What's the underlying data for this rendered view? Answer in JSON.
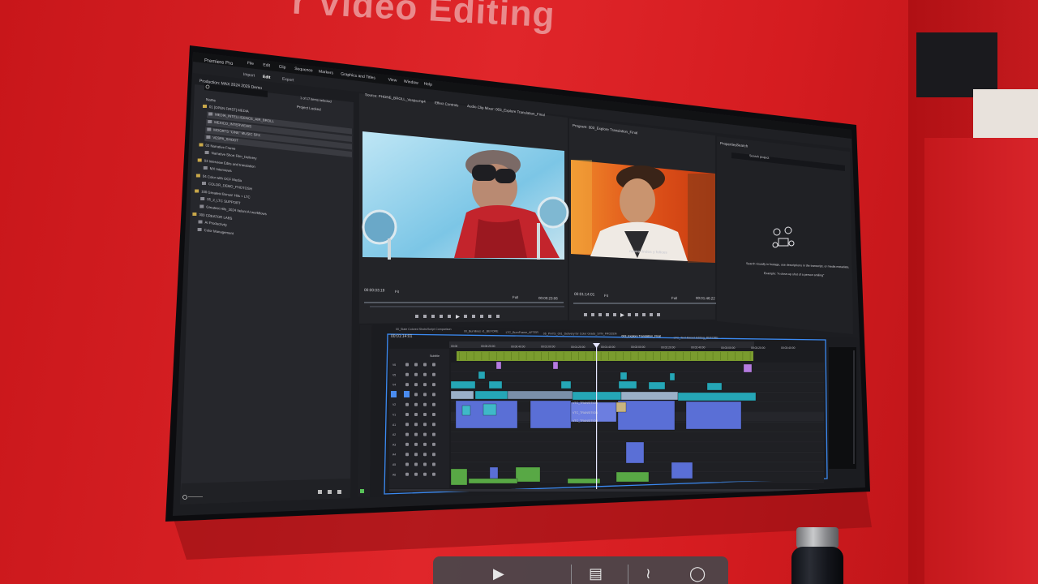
{
  "scene": {
    "wall_headline": "r Video Editing",
    "wall_color": "#d71e22"
  },
  "app": {
    "name": "Premiere Pro",
    "menus": [
      "File",
      "Edit",
      "Clip",
      "Sequence",
      "Markers",
      "Graphics and Titles",
      "View",
      "Window",
      "Help"
    ],
    "workspace_tabs": [
      "Import",
      "Edit",
      "Export"
    ],
    "production_title": "Production: MAX 2024 2025 Demo"
  },
  "project_panel": {
    "column_name": "Name",
    "column_status": "Project Locked",
    "items_selected": "1 of 17 items selected",
    "items": [
      {
        "label": "01 [OPEN FIRST] MEDIA",
        "level": 0
      },
      {
        "label": "MEDIA_INTELLIGENCE_AIR_BROLL",
        "level": 1
      },
      {
        "label": "MEXICO_INTERVIEWS",
        "level": 1
      },
      {
        "label": "MOGRTS \"CINE\" MUSIC SFX",
        "level": 1
      },
      {
        "label": "VESPA_SHOOT",
        "level": 1
      },
      {
        "label": "02 Narrative Frame",
        "level": 0
      },
      {
        "label": "Narrative Short Film_Delivery",
        "level": 1
      },
      {
        "label": "03 Interview Edits and translation",
        "level": 0
      },
      {
        "label": "MX Interviews",
        "level": 1
      },
      {
        "label": "04 Color with OCF Media",
        "level": 0
      },
      {
        "label": "COLOR_DEMO_PHOTOSH",
        "level": 1
      },
      {
        "label": "100 Greatest Bonus! Hits + LTC",
        "level": 0
      },
      {
        "label": "05_2_LTC SUPPORT",
        "level": 1
      },
      {
        "label": "Greatest Hits_2024 Itelani AI workflows",
        "level": 1
      },
      {
        "label": "300 CREATOR LABS",
        "level": 0
      },
      {
        "label": "AI Productivity",
        "level": 1
      },
      {
        "label": "Color Management",
        "level": 1
      }
    ]
  },
  "source_monitor": {
    "tab_label": "Source: PHONE_BROLL_Vespa.mp4",
    "tab_effect_controls": "Effect Controls",
    "tab_audio_mixer": "Audio Clip Mixer: 003_Explore Translation_Final",
    "timecode_in": "00:00:03:19",
    "fit": "Fit",
    "timecode_out": "00:00:23:06",
    "ratio": "Full"
  },
  "program_monitor": {
    "tab_label": "Program: 003_Explore Translation_Final",
    "caption_line": "nuevo lindos y felices",
    "timecode_in": "00:01:14:01",
    "fit": "Fit",
    "timecode_out": "00:01:46:22",
    "ratio": "Full"
  },
  "properties_panel": {
    "tab_properties": "Properties",
    "tab_search": "Search",
    "search_placeholder": "Search project",
    "hint_line_1": "Search visually in footage, use descriptions in the transcript, or media metadata.",
    "hint_line_2": "Example: \"A close-up shot of a person smiling\""
  },
  "timeline": {
    "tabs": [
      "00_Slate Colored Shots/Script Comparison",
      "00_Burnlines v1_BEFORE",
      "LTC_BurnFrame_AFTER",
      "06_PHYS_001_Delivery for Color Grade_SYN_FROZEN",
      "003_Explore Translation_Final",
      "LTC_Text Based Editing_BEFORE"
    ],
    "active_tab_index": 4,
    "timecode": "00:01:14:01",
    "ruler": [
      "00:00",
      "00:00:20:00",
      "00:00:40:00",
      "00:01:00:00",
      "00:01:20:00",
      "00:01:40:00",
      "00:02:00:00",
      "00:02:20:00",
      "00:02:40:00",
      "00:03:00:00",
      "00:03:20:00",
      "00:03:40:00"
    ],
    "tracks": [
      "V6",
      "V5",
      "V4",
      "V3",
      "V2",
      "V1",
      "A1",
      "A2",
      "A3",
      "A4",
      "A5",
      "A6"
    ],
    "subtitle_track": "Subtitle",
    "clip_labels": [
      "VTC_TRANSITION",
      "VTC_TRANSITION",
      "VTC_TRANSITION"
    ],
    "colors": {
      "video_blue": "#5a6fd6",
      "video_teal": "#25a6b6",
      "audio_green": "#58a845",
      "subtitle_green": "#7a9c2e",
      "graphic_purple": "#b57be0",
      "playhead": "#e6e6ff",
      "selection_outline": "#3b8af2"
    }
  },
  "player_controls": {
    "play_icon": "play-icon",
    "captions_icon": "captions-icon",
    "volume_icon": "volume-icon",
    "settings_icon": "settings-icon"
  },
  "props": {
    "bottle": "water-bottle"
  }
}
